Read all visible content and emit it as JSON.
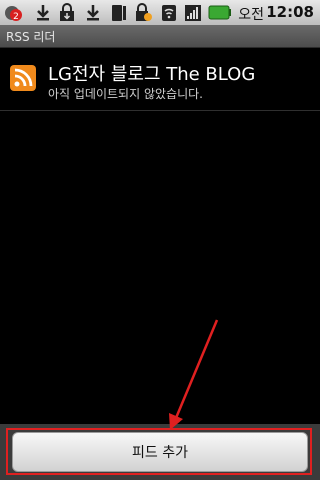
{
  "status_bar": {
    "notification_count": "2",
    "ampm": "오전",
    "time": "12:08"
  },
  "app": {
    "title": "RSS 리더"
  },
  "feed": {
    "title": "LG전자 블로그 The BLOG",
    "subtitle": "아직 업데이트되지 않았습니다."
  },
  "actions": {
    "add_feed_label": "피드 추가"
  },
  "colors": {
    "rss_orange": "#f08a1c",
    "highlight_red": "#e02020"
  }
}
